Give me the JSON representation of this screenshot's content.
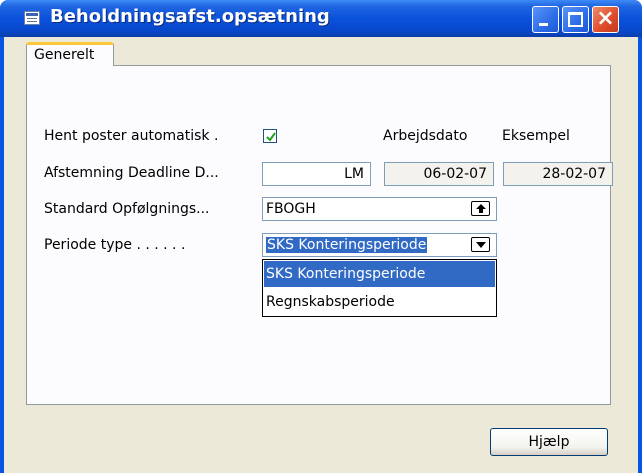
{
  "window": {
    "title": "Beholdningsafst.opsætning",
    "controls": {
      "minimize": "minimize-icon",
      "maximize": "maximize-icon",
      "close": "×"
    }
  },
  "tabs": [
    {
      "label": "Generelt",
      "active": true
    }
  ],
  "form": {
    "row1": {
      "label": "Hent poster automatisk .",
      "checked": true,
      "col_headers": [
        "Arbejdsdato",
        "Eksempel"
      ]
    },
    "row2": {
      "label": "Afstemning Deadline D...",
      "value": "LM",
      "work_date": "06-02-07",
      "example": "28-02-07"
    },
    "row3": {
      "label": "Standard Opfølgnings...",
      "value": "FBOGH"
    },
    "row4": {
      "label": "Periode type . . . . . .",
      "value": "SKS Konteringsperiode"
    }
  },
  "dropdown": {
    "options": [
      {
        "label": "SKS Konteringsperiode",
        "selected": true
      },
      {
        "label": "Regnskabsperiode",
        "selected": false
      }
    ]
  },
  "buttons": {
    "help": "Hjælp"
  },
  "colors": {
    "titlebar": "#0a54e3",
    "selection": "#316ac5",
    "tab_accent": "#ffc83c",
    "face": "#ece9d8"
  }
}
